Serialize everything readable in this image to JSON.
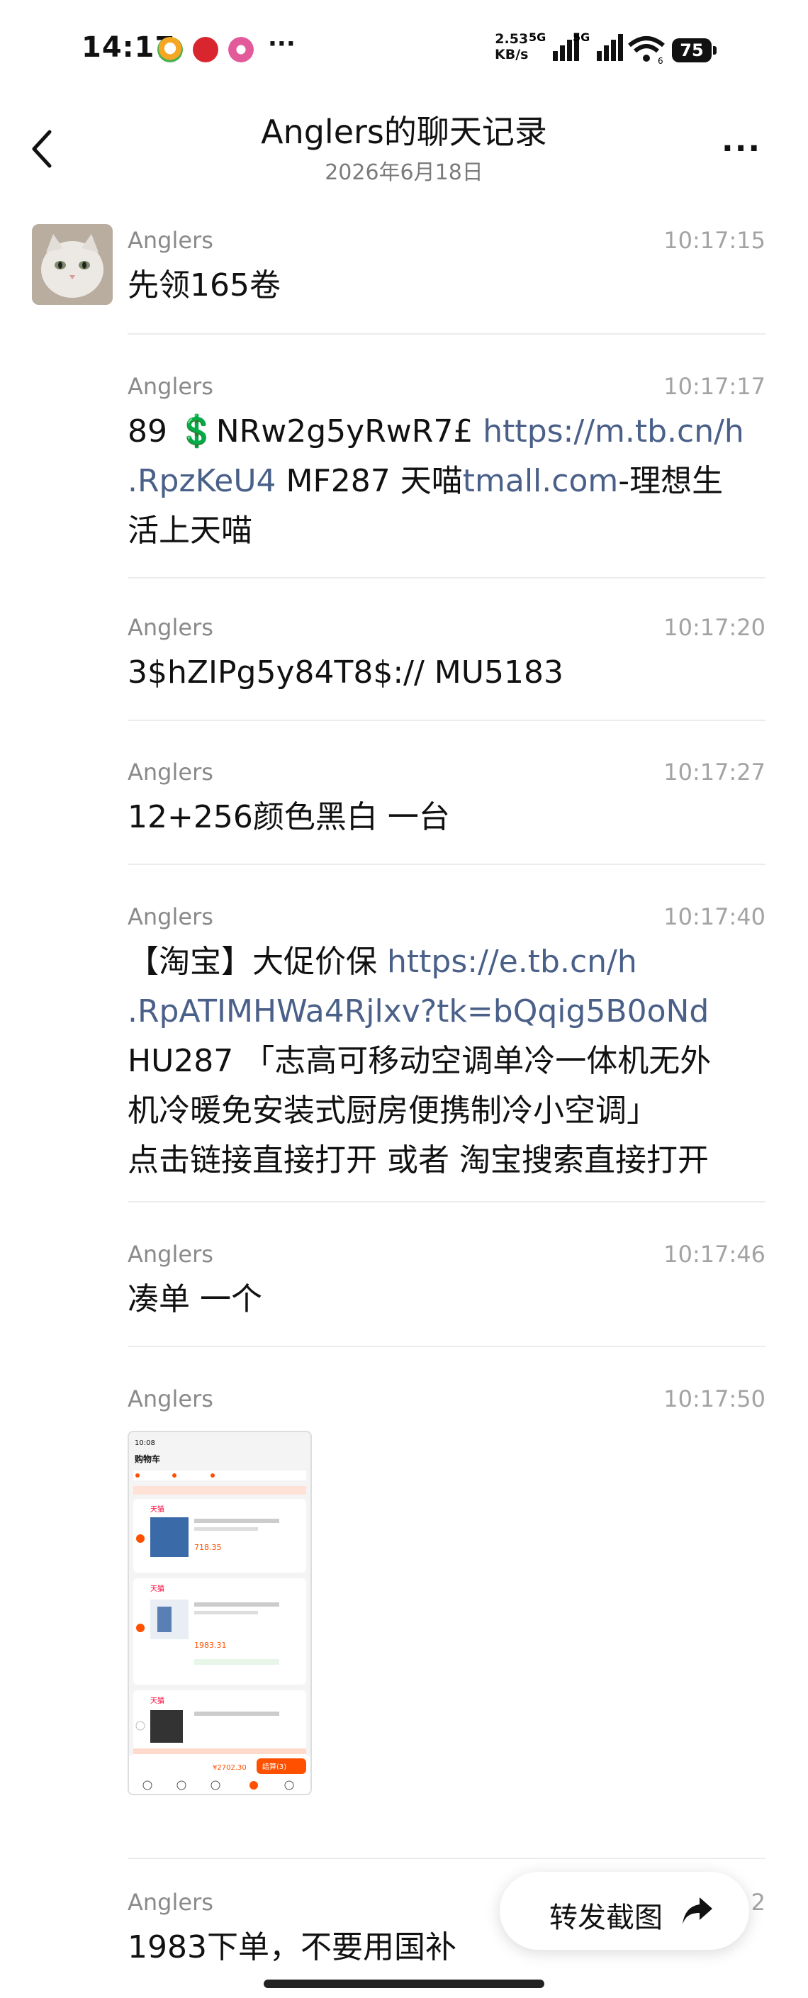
{
  "status_bar": {
    "time": "14:17",
    "more": "···",
    "net_speed": "2.53",
    "net_unit": "KB/s",
    "net1": "5G",
    "net2": "5G",
    "battery": "75"
  },
  "header": {
    "title": "Anglers的聊天记录",
    "date": "2026年6月18日",
    "more": "···"
  },
  "messages": [
    {
      "sender": "Anglers",
      "time": "10:17:15",
      "text": "先领165卷"
    },
    {
      "sender": "Anglers",
      "time": "10:17:17",
      "line1_a": "89 💲NRw2g5yRwR7£ ",
      "line1_link": "https://m.tb.cn/h",
      "line2_link": ".RpzKeU4",
      "line2_a": "  MF287 天喵",
      "line2_link2": "tmall.com",
      "line2_b": "-理想生",
      "line3": "活上天喵"
    },
    {
      "sender": "Anglers",
      "time": "10:17:20",
      "text": "3$hZIPg5y84T8$:// MU5183"
    },
    {
      "sender": "Anglers",
      "time": "10:17:27",
      "text": "12+256颜色黑白  一台"
    },
    {
      "sender": "Anglers",
      "time": "10:17:40",
      "line1_a": "【淘宝】大促价保 ",
      "line1_link": "https://e.tb.cn/h",
      "line2_link": ".RpATIMHWa4Rjlxv?tk=bQqig5B0oNd",
      "line3": "HU287 「志高可移动空调单冷一体机无外",
      "line4": "机冷暖免安装式厨房便携制冷小空调」",
      "line5": "点击链接直接打开 或者 淘宝搜索直接打开"
    },
    {
      "sender": "Anglers",
      "time": "10:17:46",
      "text": "凑单 一个"
    },
    {
      "sender": "Anglers",
      "time": "10:17:50",
      "thumb": {
        "time": "10:08",
        "title": "购物车",
        "shop1": "天猫",
        "shop2": "天猫",
        "shop3": "天猫",
        "price1": "718.35",
        "price2": "1983.31",
        "total": "¥2702.30",
        "checkout": "结算(3)"
      }
    },
    {
      "sender": "Anglers",
      "time": "2",
      "text": "1983下单，不要用国补"
    }
  ],
  "forward_button": {
    "label": "转发截图"
  },
  "colors": {
    "link": "#4a6089",
    "accent": "#ff5000"
  }
}
